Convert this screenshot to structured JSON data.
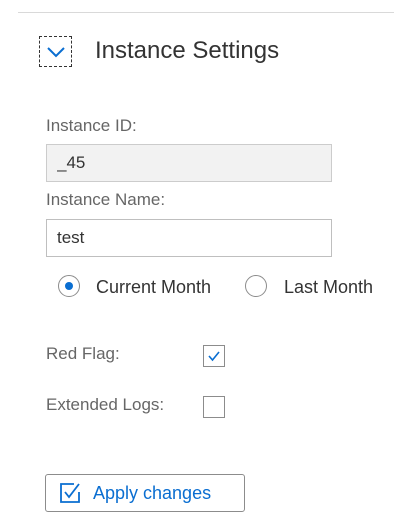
{
  "section": {
    "title": "Instance Settings",
    "toggle_icon": "chevron-down-icon"
  },
  "instance_id": {
    "label": "Instance ID:",
    "value": "_45",
    "editable": false
  },
  "instance_name": {
    "label": "Instance Name:",
    "value": "test",
    "editable": true
  },
  "period": {
    "options": [
      {
        "label": "Current Month",
        "selected": true
      },
      {
        "label": "Last Month",
        "selected": false
      }
    ]
  },
  "flags": {
    "red_flag": {
      "label": "Red Flag:",
      "checked": true
    },
    "extended_logs": {
      "label": "Extended Logs:",
      "checked": false
    }
  },
  "apply_button": {
    "label": "Apply changes",
    "icon": "checkbox-check-icon"
  },
  "colors": {
    "accent": "#0a6ed1",
    "label_text": "#666666",
    "readonly_bg": "#f2f2f2",
    "border": "#8c8c8c"
  }
}
